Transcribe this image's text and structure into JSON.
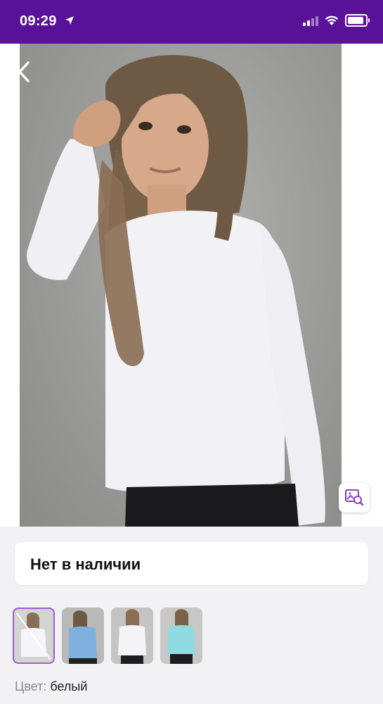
{
  "status_bar": {
    "time": "09:29"
  },
  "product": {
    "availability": "Нет в наличии",
    "color_label": "Цвет:",
    "color_value": "белый"
  },
  "thumbnails": [
    {
      "variant": "white",
      "selected": true
    },
    {
      "variant": "blue",
      "selected": false
    },
    {
      "variant": "white",
      "selected": false
    },
    {
      "variant": "turquoise",
      "selected": false
    }
  ],
  "colors": {
    "status_bar": "#5a1199",
    "selected_thumb_border": "#a05ed2"
  },
  "icons": [
    "back-arrow-icon",
    "share-icon",
    "visual-search-icon",
    "location-arrow-icon",
    "signal-icon",
    "wifi-icon",
    "battery-icon"
  ]
}
